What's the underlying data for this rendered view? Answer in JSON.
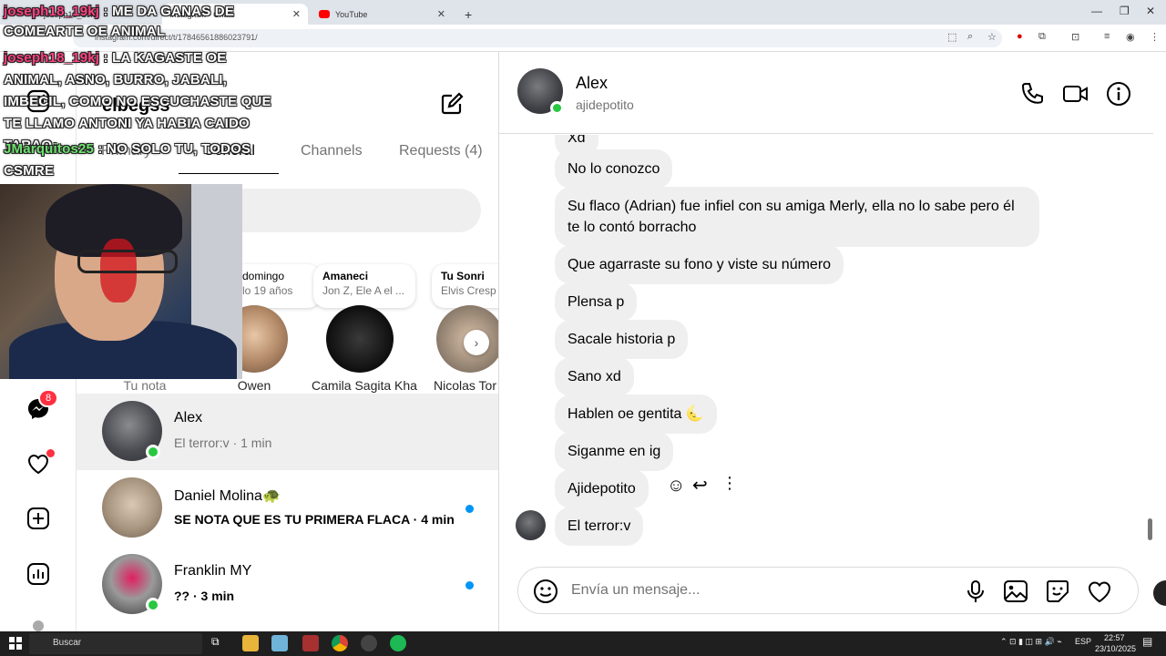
{
  "browser": {
    "tabs": [
      {
        "label": "joseph18_19kj",
        "active": false
      },
      {
        "label": "Instagram • Chats",
        "active": true
      },
      {
        "label": "YouTube",
        "active": false
      }
    ],
    "url": "instagram.com/direct/t/17846561886023791/"
  },
  "stream_chat": [
    {
      "user": "joseph18_19kj",
      "text": ": ME DA GANAS DE COMEARTE OE ANIMAL"
    },
    {
      "user": "joseph18_19kj",
      "text": ": LA KAGASTE OE ANIMAL, ASNO, BURRO, JABALI, IMBECIL, COMO NO ESCUCHASTE QUE TE LLAMO ANTONI YA HABIA CAIDO TARAO"
    },
    {
      "user": "JMarquitos25",
      "text": ": NO SOLO TU, TODOS CSMRE"
    }
  ],
  "ig_left": {
    "account_name": "elbegss",
    "tabs": [
      "Primary",
      "General",
      "Channels",
      "Requests (4)"
    ],
    "notes": [
      {
        "title": "domingo",
        "sub": "lo 19 años"
      },
      {
        "title": "Amaneci",
        "sub": "Jon Z, Ele A el ..."
      },
      {
        "title": "Tu Sonri",
        "sub": "Elvis Cresp"
      }
    ],
    "stories": [
      "Tu nota",
      "Owen",
      "Camila Sagita Kha",
      "Nicolas Tor"
    ],
    "messenger_badge": "8",
    "conversations": [
      {
        "name": "Alex",
        "preview": "El terror:v · 1 min",
        "online": true,
        "unread": false
      },
      {
        "name": "Daniel Molina🐢",
        "preview": "SE NOTA QUE ES TU PRIMERA FLACA · 4 min",
        "online": false,
        "unread": true
      },
      {
        "name": "Franklin MY",
        "preview": "?? · 3 min",
        "online": true,
        "unread": true
      }
    ]
  },
  "chat": {
    "name": "Alex",
    "username": "ajidepotito",
    "messages": [
      "Xd",
      "No lo conozco",
      "Su flaco (Adrian) fue infiel con su amiga Merly, ella no lo sabe pero él te lo contó borracho",
      "Que agarraste su fono y viste su número",
      "Plensa p",
      "Sacale historia p",
      "Sano xd",
      "Hablen oe gentita 🌜",
      "Siganme en ig",
      "Ajidepotito",
      "El terror:v"
    ],
    "composer_placeholder": "Envía un mensaje..."
  },
  "taskbar": {
    "search_label": "Buscar",
    "language": "ESP",
    "time": "22:57",
    "date": "23/10/2025"
  }
}
